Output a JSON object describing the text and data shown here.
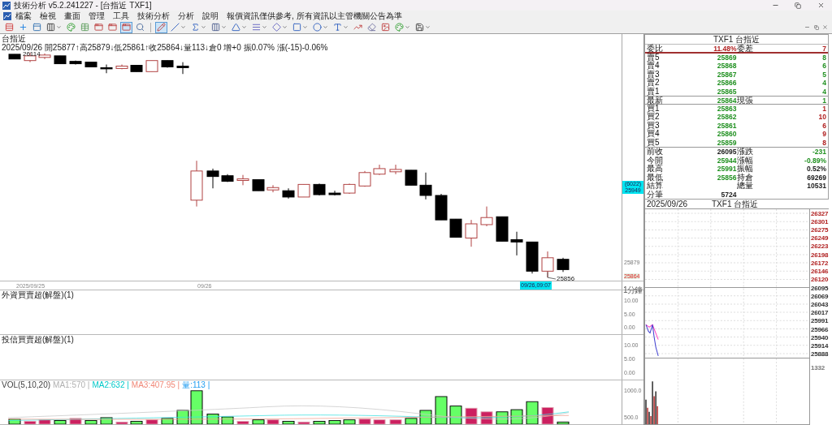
{
  "window": {
    "title": "技術分析 v5.2.241227 - [台指近 TXF1]"
  },
  "menu": {
    "items": [
      "檔案",
      "檢視",
      "畫面",
      "管理",
      "工具",
      "技術分析",
      "分析",
      "說明"
    ],
    "notice": "報價資訊僅供參考, 所有資訊以主管機關公告為準"
  },
  "toolbar": [
    {
      "kind": "layout",
      "selected": false,
      "dropdown": false
    },
    {
      "kind": "add",
      "selected": false,
      "dropdown": false
    },
    {
      "kind": "ruler",
      "selected": false,
      "dropdown": false
    },
    {
      "kind": "columns",
      "selected": false,
      "dropdown": true
    },
    {
      "kind": "colors",
      "selected": false,
      "dropdown": false
    },
    {
      "kind": "grid",
      "selected": false,
      "dropdown": false
    },
    {
      "kind": "window",
      "selected": false,
      "dropdown": false
    },
    {
      "kind": "window",
      "selected": false,
      "dropdown": false
    },
    {
      "kind": "window",
      "selected": true,
      "dropdown": false
    },
    {
      "kind": "zoom",
      "selected": false,
      "dropdown": false
    },
    {
      "kind": "separator"
    },
    {
      "kind": "pencil",
      "selected": true,
      "dropdown": false
    },
    {
      "kind": "line",
      "selected": false,
      "dropdown": true
    },
    {
      "kind": "sigma",
      "selected": false,
      "dropdown": true
    },
    {
      "kind": "bars",
      "selected": false,
      "dropdown": true
    },
    {
      "kind": "fan",
      "selected": false,
      "dropdown": true
    },
    {
      "kind": "fib",
      "selected": false,
      "dropdown": true
    },
    {
      "kind": "diamond",
      "selected": false,
      "dropdown": true
    },
    {
      "kind": "rect",
      "selected": false,
      "dropdown": true
    },
    {
      "kind": "circle",
      "selected": false,
      "dropdown": true
    },
    {
      "kind": "text",
      "selected": false,
      "dropdown": true
    },
    {
      "kind": "trend",
      "selected": false,
      "dropdown": false
    },
    {
      "kind": "eraser",
      "selected": false,
      "dropdown": false
    },
    {
      "kind": "image",
      "selected": false,
      "dropdown": false
    },
    {
      "kind": "colors",
      "selected": false,
      "dropdown": true
    },
    {
      "kind": "save",
      "selected": false,
      "dropdown": true
    }
  ],
  "chart": {
    "title": "台指近",
    "summary": "2025/09/26 開25877↑高25879↓低25861↑收25864↓量113↓倉0 增+0 振0.07% 漲(-15)-0.06%",
    "high_label": "26114",
    "low_label": "25856",
    "axis": [
      {
        "text": "25879",
        "highlight": false
      },
      {
        "text": "25864",
        "highlight": true
      }
    ],
    "cursor_price": [
      "(6022)",
      "25949"
    ],
    "dates": [
      "2025/09/25",
      "09/26"
    ],
    "cursor_time": "09/26,09:07",
    "interval": "1分鐘"
  },
  "indicators": [
    {
      "title": "外資買賣超(解盤)(1)",
      "axis": [
        "10.00",
        "5.00",
        "0.00"
      ]
    },
    {
      "title": "投信買賣超(解盤)(1)",
      "axis": [
        "10.00",
        "5.00",
        "0.00"
      ]
    }
  ],
  "volume": {
    "legend": [
      {
        "text": "VOL(5,10,20)",
        "color": "#404040"
      },
      {
        "text": "MA1:570 |",
        "color": "#b0b0b0"
      },
      {
        "text": "MA2:632 |",
        "color": "#00c8c8"
      },
      {
        "text": "MA3:407.95 |",
        "color": "#f08878"
      },
      {
        "text": "量:113 |",
        "color": "#1e9cf0"
      }
    ],
    "axis": [
      "1000.0",
      "500.0"
    ]
  },
  "quote": {
    "title": "TXF1 台指近",
    "rows": [
      {
        "kind": "ratio",
        "label": "委比",
        "value": {
          "text": "11.48%",
          "color": "#b02020"
        },
        "label2": "委差",
        "value2": {
          "text": "7",
          "color": "#b02020"
        }
      },
      {
        "kind": "ask",
        "label": "賣5",
        "value": {
          "text": "25869",
          "color": "#209020"
        },
        "value2": {
          "text": "8",
          "color": "#209020"
        }
      },
      {
        "kind": "ask",
        "label": "賣4",
        "value": {
          "text": "25868",
          "color": "#209020"
        },
        "value2": {
          "text": "6",
          "color": "#209020"
        }
      },
      {
        "kind": "ask",
        "label": "賣3",
        "value": {
          "text": "25867",
          "color": "#209020"
        },
        "value2": {
          "text": "5",
          "color": "#209020"
        }
      },
      {
        "kind": "ask",
        "label": "賣2",
        "value": {
          "text": "25866",
          "color": "#209020"
        },
        "value2": {
          "text": "4",
          "color": "#209020"
        }
      },
      {
        "kind": "ask",
        "label": "賣1",
        "value": {
          "text": "25865",
          "color": "#209020"
        },
        "value2": {
          "text": "4",
          "color": "#209020"
        }
      },
      {
        "kind": "last",
        "label": "最新",
        "value": {
          "text": "25864",
          "color": "#209020"
        },
        "label2": "現張",
        "value2": {
          "text": "1",
          "color": "#209020"
        }
      },
      {
        "kind": "bid",
        "label": "買1",
        "value": {
          "text": "25863",
          "color": "#209020"
        },
        "value2": {
          "text": "1",
          "color": "#b02020"
        }
      },
      {
        "kind": "bid",
        "label": "買2",
        "value": {
          "text": "25862",
          "color": "#209020"
        },
        "value2": {
          "text": "10",
          "color": "#b02020"
        }
      },
      {
        "kind": "bid",
        "label": "買3",
        "value": {
          "text": "25861",
          "color": "#209020"
        },
        "value2": {
          "text": "6",
          "color": "#b02020"
        }
      },
      {
        "kind": "bid",
        "label": "買4",
        "value": {
          "text": "25860",
          "color": "#209020"
        },
        "value2": {
          "text": "9",
          "color": "#b02020"
        }
      },
      {
        "kind": "bid",
        "label": "買5",
        "value": {
          "text": "25859",
          "color": "#209020"
        },
        "value2": {
          "text": "8",
          "color": "#b02020"
        }
      },
      {
        "kind": "stat",
        "label": "前收",
        "value": {
          "text": "26095",
          "color": "#202020"
        },
        "label2": "漲跌",
        "value2": {
          "text": "-231",
          "color": "#209020"
        }
      },
      {
        "kind": "stat",
        "label": "今開",
        "value": {
          "text": "25944",
          "color": "#209020"
        },
        "label2": "漲幅",
        "value2": {
          "text": "-0.89%",
          "color": "#209020"
        }
      },
      {
        "kind": "stat",
        "label": "最高",
        "value": {
          "text": "25991",
          "color": "#209020"
        },
        "label2": "振幅",
        "value2": {
          "text": "0.52%",
          "color": "#202020"
        }
      },
      {
        "kind": "stat",
        "label": "最低",
        "value": {
          "text": "25856",
          "color": "#209020"
        },
        "label2": "持倉",
        "value2": {
          "text": "69269",
          "color": "#202020"
        }
      },
      {
        "kind": "stat",
        "label": "結算",
        "label2": "總量",
        "value2": {
          "text": "10531",
          "color": "#202020"
        }
      },
      {
        "kind": "stat",
        "label": "分筆",
        "value": {
          "text": "5724",
          "color": "#202020"
        }
      }
    ]
  },
  "intraday": {
    "date": "2025/09/26",
    "title": "TXF1 台指近",
    "axis": [
      {
        "text": "26327",
        "color": "#b02020"
      },
      {
        "text": "26301",
        "color": "#b02020"
      },
      {
        "text": "26275",
        "color": "#b02020"
      },
      {
        "text": "26249",
        "color": "#b02020"
      },
      {
        "text": "26223",
        "color": "#b02020"
      },
      {
        "text": "26198",
        "color": "#b02020"
      },
      {
        "text": "26172",
        "color": "#b02020"
      },
      {
        "text": "26146",
        "color": "#b02020"
      },
      {
        "text": "26120",
        "color": "#b02020"
      },
      {
        "text": "26095",
        "color": "#303030"
      },
      {
        "text": "26069",
        "color": "#303030"
      },
      {
        "text": "26043",
        "color": "#303030"
      },
      {
        "text": "26017",
        "color": "#303030"
      },
      {
        "text": "25991",
        "color": "#303030"
      },
      {
        "text": "25966",
        "color": "#303030"
      },
      {
        "text": "25940",
        "color": "#303030"
      },
      {
        "text": "25914",
        "color": "#303030"
      },
      {
        "text": "25888",
        "color": "#303030"
      }
    ],
    "volume_axis": "1332"
  }
}
